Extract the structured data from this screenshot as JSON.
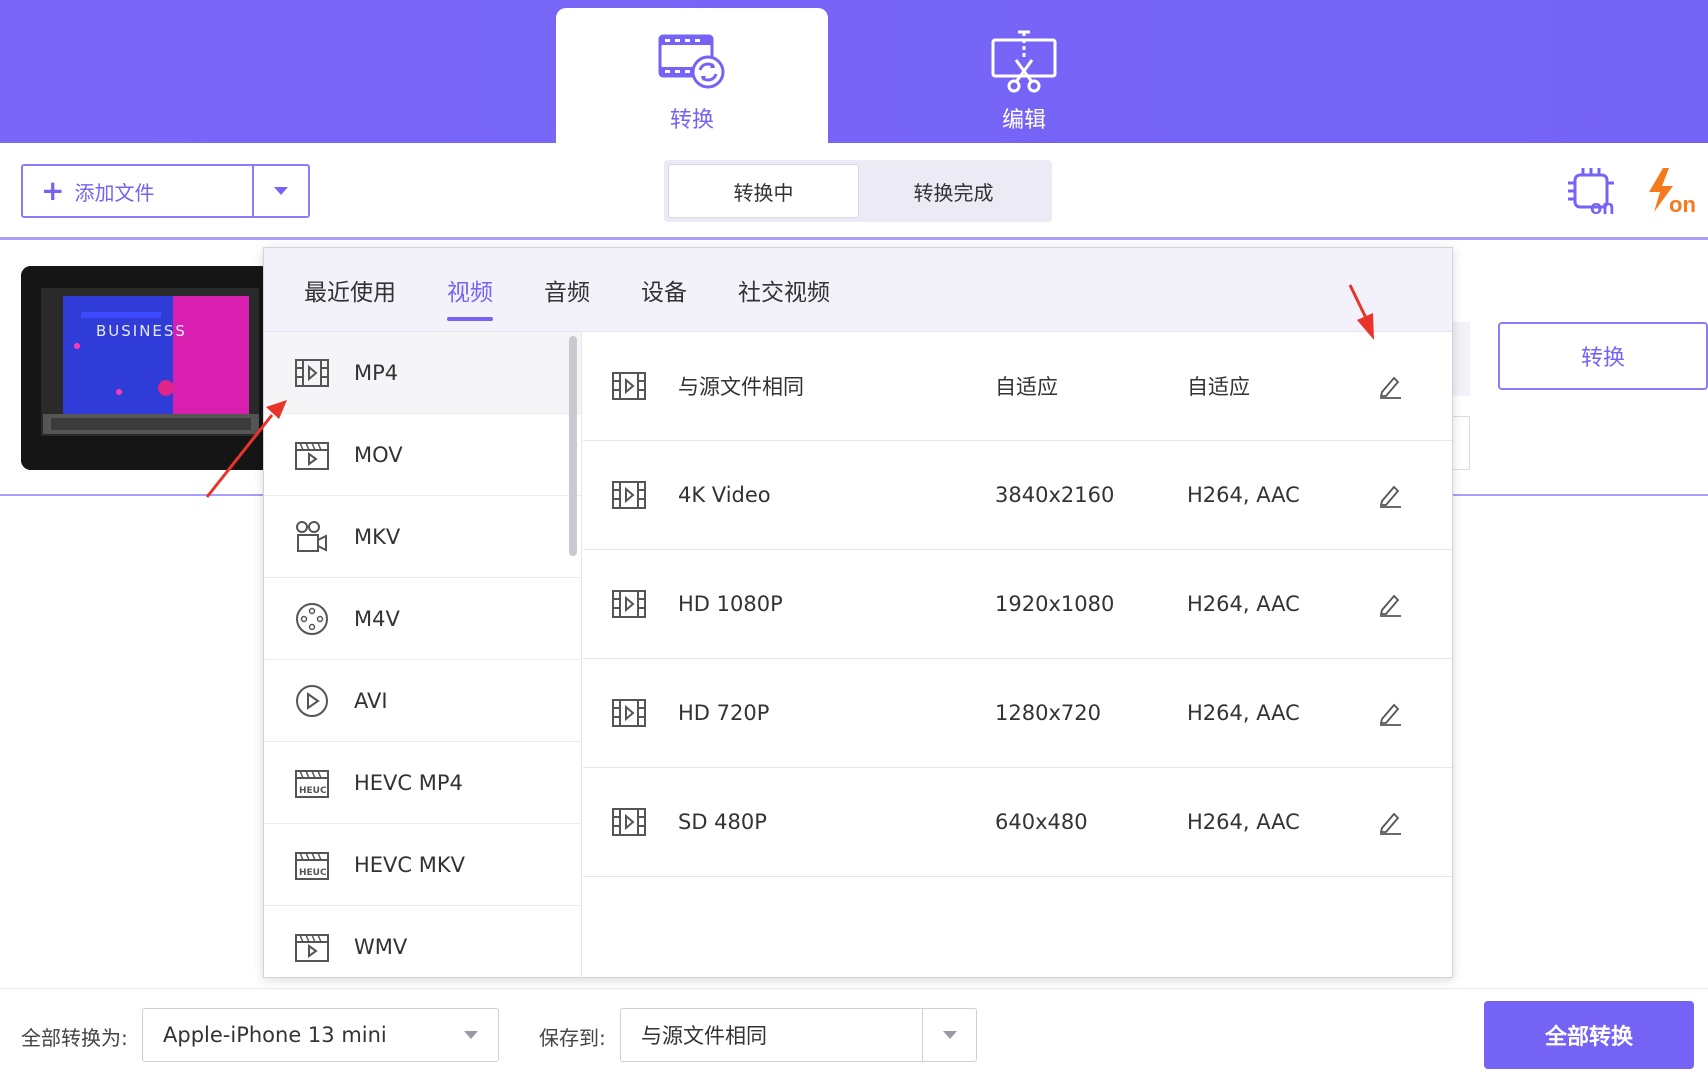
{
  "header": {
    "tabs": [
      {
        "label": "转换",
        "icon": "film-convert-icon",
        "active": true
      },
      {
        "label": "编辑",
        "icon": "cut-edit-icon",
        "active": false
      }
    ]
  },
  "toolbar": {
    "add_file_label": "添加文件",
    "segment": [
      "转换中",
      "转换完成"
    ],
    "segment_active": "转换中",
    "right_icons": [
      "gpu-on-icon",
      "lightning-on-icon"
    ]
  },
  "file_item": {
    "thumbnail_text": "BUSINESS",
    "convert_label": "转换"
  },
  "popup": {
    "tabs": [
      "最近使用",
      "视频",
      "音频",
      "设备",
      "社交视频"
    ],
    "active_tab": "视频",
    "formats": [
      {
        "label": "MP4",
        "icon": "film-icon",
        "selected": true
      },
      {
        "label": "MOV",
        "icon": "clapper-icon",
        "selected": false
      },
      {
        "label": "MKV",
        "icon": "camera-icon",
        "selected": false
      },
      {
        "label": "M4V",
        "icon": "reel-icon",
        "selected": false
      },
      {
        "label": "AVI",
        "icon": "play-circle-icon",
        "selected": false
      },
      {
        "label": "HEVC MP4",
        "icon": "hevc-icon",
        "selected": false
      },
      {
        "label": "HEVC MKV",
        "icon": "hevc-icon",
        "selected": false
      },
      {
        "label": "WMV",
        "icon": "clapper-icon",
        "selected": false
      }
    ],
    "presets": [
      {
        "name": "与源文件相同",
        "resolution": "自适应",
        "codec": "自适应"
      },
      {
        "name": "4K Video",
        "resolution": "3840x2160",
        "codec": "H264, AAC"
      },
      {
        "name": "HD 1080P",
        "resolution": "1920x1080",
        "codec": "H264, AAC"
      },
      {
        "name": "HD 720P",
        "resolution": "1280x720",
        "codec": "H264, AAC"
      },
      {
        "name": "SD 480P",
        "resolution": "640x480",
        "codec": "H264, AAC"
      }
    ]
  },
  "bottom": {
    "convert_all_to_label": "全部转换为:",
    "convert_all_to_value": "Apple-iPhone 13 mini",
    "save_to_label": "保存到:",
    "save_to_value": "与源文件相同",
    "convert_all_button": "全部转换"
  },
  "colors": {
    "accent": "#7563f6",
    "annotation_arrow": "#e8342a"
  }
}
